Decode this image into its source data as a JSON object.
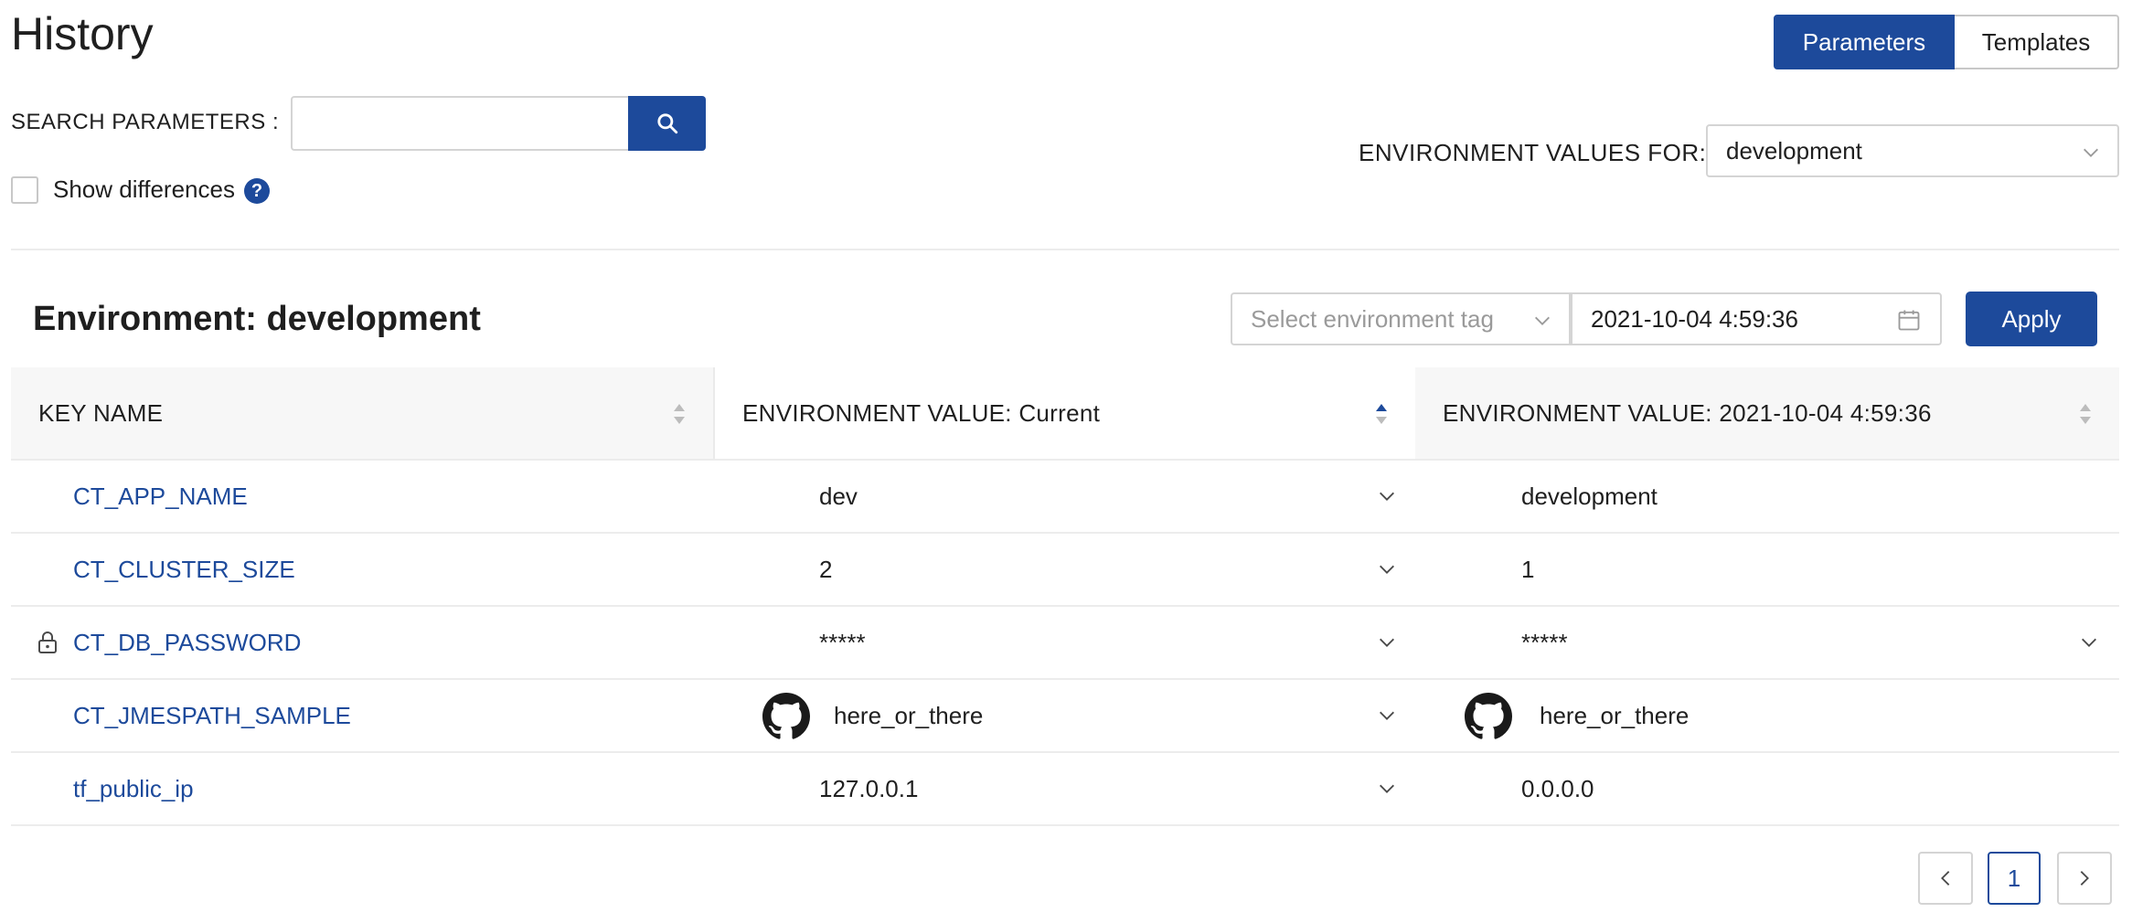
{
  "header": {
    "title": "History",
    "view_toggle": {
      "parameters": "Parameters",
      "templates": "Templates",
      "active": "Parameters"
    }
  },
  "search": {
    "label": "SEARCH PARAMETERS :",
    "value": "",
    "placeholder": ""
  },
  "show_differences": {
    "label": "Show differences",
    "checked": false,
    "help": "?"
  },
  "environment_filter": {
    "label": "ENVIRONMENT VALUES FOR:",
    "selected": "development"
  },
  "section": {
    "title": "Environment: development",
    "tag_placeholder": "Select environment tag",
    "date_value": "2021-10-04 4:59:36",
    "apply_label": "Apply"
  },
  "table": {
    "headers": {
      "key": "KEY NAME",
      "current": "ENVIRONMENT VALUE: Current",
      "compare": "ENVIRONMENT VALUE: 2021-10-04 4:59:36"
    },
    "rows": [
      {
        "key": "CT_APP_NAME",
        "current": "dev",
        "compare": "development",
        "secret": false,
        "github": false
      },
      {
        "key": "CT_CLUSTER_SIZE",
        "current": "2",
        "compare": "1",
        "secret": false,
        "github": false
      },
      {
        "key": "CT_DB_PASSWORD",
        "current": "*****",
        "compare": "*****",
        "secret": true,
        "github": false
      },
      {
        "key": "CT_JMESPATH_SAMPLE",
        "current": "here_or_there",
        "compare": "here_or_there",
        "secret": false,
        "github": true
      },
      {
        "key": "tf_public_ip",
        "current": "127.0.0.1",
        "compare": "0.0.0.0",
        "secret": false,
        "github": false
      }
    ]
  },
  "pagination": {
    "current_page": "1"
  },
  "colors": {
    "primary": "#1d4a9b",
    "border": "#d4d4d4",
    "header_bg": "#f7f7f7"
  }
}
